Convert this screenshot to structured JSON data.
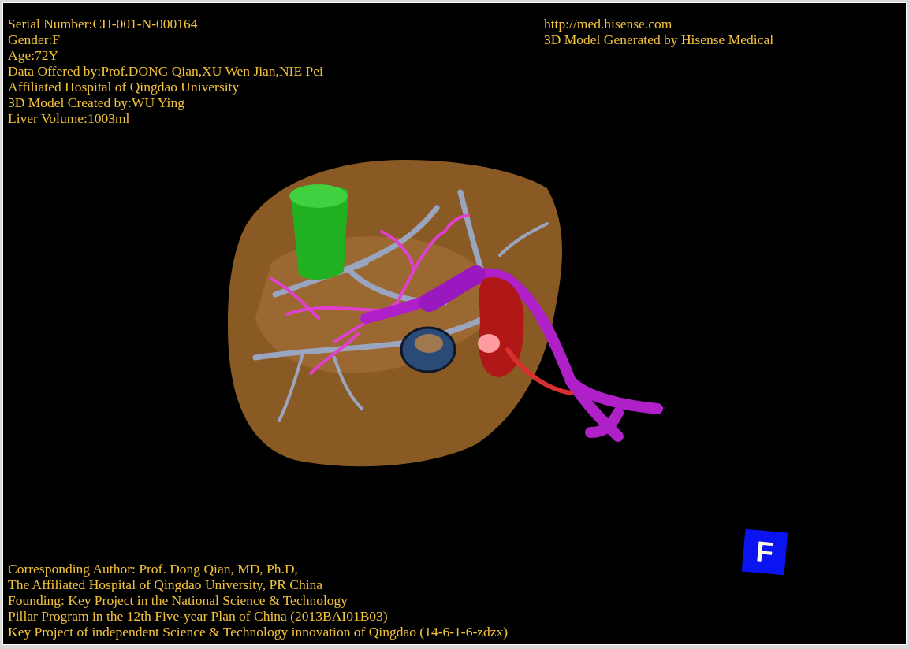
{
  "header_left": [
    "Serial Number:CH-001-N-000164",
    "Gender:F",
    "Age:72Y",
    "Data Offered by:Prof.DONG Qian,XU Wen Jian,NIE Pei",
    "Affiliated Hospital of Qingdao University",
    "3D Model Created by:WU Ying",
    "Liver Volume:1003ml"
  ],
  "header_right": [
    "http://med.hisense.com",
    "3D Model Generated by Hisense Medical"
  ],
  "footer": [
    "Corresponding Author: Prof. Dong Qian, MD, Ph.D,",
    "The Affiliated Hospital of Qingdao University, PR China",
    "Founding: Key Project in the National Science & Technology",
    "Pillar Program in the 12th Five-year Plan of China (2013BAI01B03)",
    "Key Project of independent Science & Technology innovation of Qingdao (14-6-1-6-zdzx)"
  ],
  "orientation_marker": {
    "label": "F"
  }
}
